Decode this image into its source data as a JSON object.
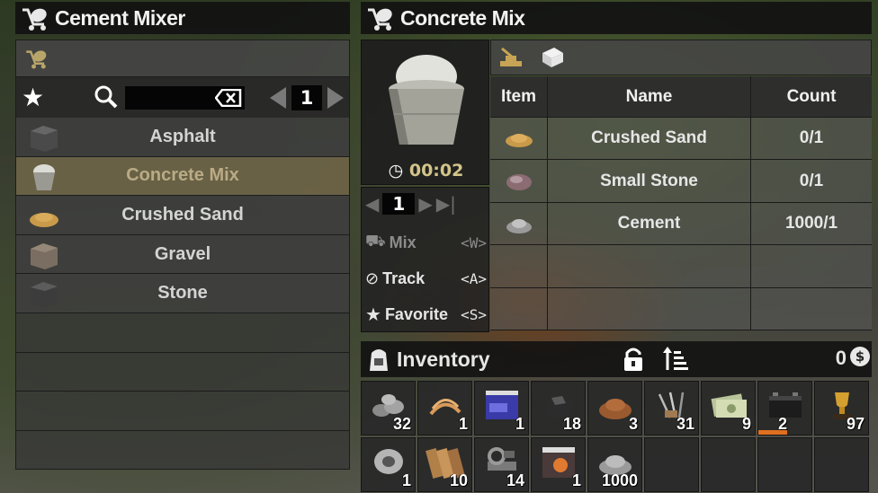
{
  "left_header": {
    "title": "Cement Mixer"
  },
  "search": {
    "page": "1"
  },
  "recipes": [
    {
      "label": "Asphalt"
    },
    {
      "label": "Concrete Mix"
    },
    {
      "label": "Crushed Sand"
    },
    {
      "label": "Gravel"
    },
    {
      "label": "Stone"
    }
  ],
  "right_header": {
    "title": "Concrete Mix"
  },
  "craft_info": {
    "time": "00:02",
    "quantity": "1"
  },
  "actions": [
    {
      "label": "Mix",
      "key": "<W>"
    },
    {
      "label": "Track",
      "key": "<A>"
    },
    {
      "label": "Favorite",
      "key": "<S>"
    }
  ],
  "ingredients": {
    "headers": [
      "Item",
      "Name",
      "Count"
    ],
    "rows": [
      {
        "name": "Crushed Sand",
        "count": "0/1"
      },
      {
        "name": "Small Stone",
        "count": "0/1"
      },
      {
        "name": "Cement",
        "count": "1000/1"
      }
    ]
  },
  "inventory": {
    "title": "Inventory",
    "money": "0",
    "slots": [
      {
        "item": "small-stones",
        "count": "32"
      },
      {
        "item": "plant-fibers",
        "count": "1"
      },
      {
        "item": "magazine",
        "count": "1"
      },
      {
        "item": "coal",
        "count": "18"
      },
      {
        "item": "clay-soil",
        "count": "3"
      },
      {
        "item": "nails",
        "count": "31"
      },
      {
        "item": "cash",
        "count": "9"
      },
      {
        "item": "car-battery",
        "count": "2"
      },
      {
        "item": "trophy",
        "count": "97"
      },
      {
        "item": "duct-tape",
        "count": "1"
      },
      {
        "item": "wood-planks",
        "count": "10"
      },
      {
        "item": "scrap-iron",
        "count": "14"
      },
      {
        "item": "forge-ahead-book",
        "count": "1"
      },
      {
        "item": "cement-powder",
        "count": "1000"
      }
    ]
  },
  "colors": {
    "selected_row": "#6e6448",
    "time_text": "#d3c48a",
    "battery_bar": "#e07020"
  }
}
